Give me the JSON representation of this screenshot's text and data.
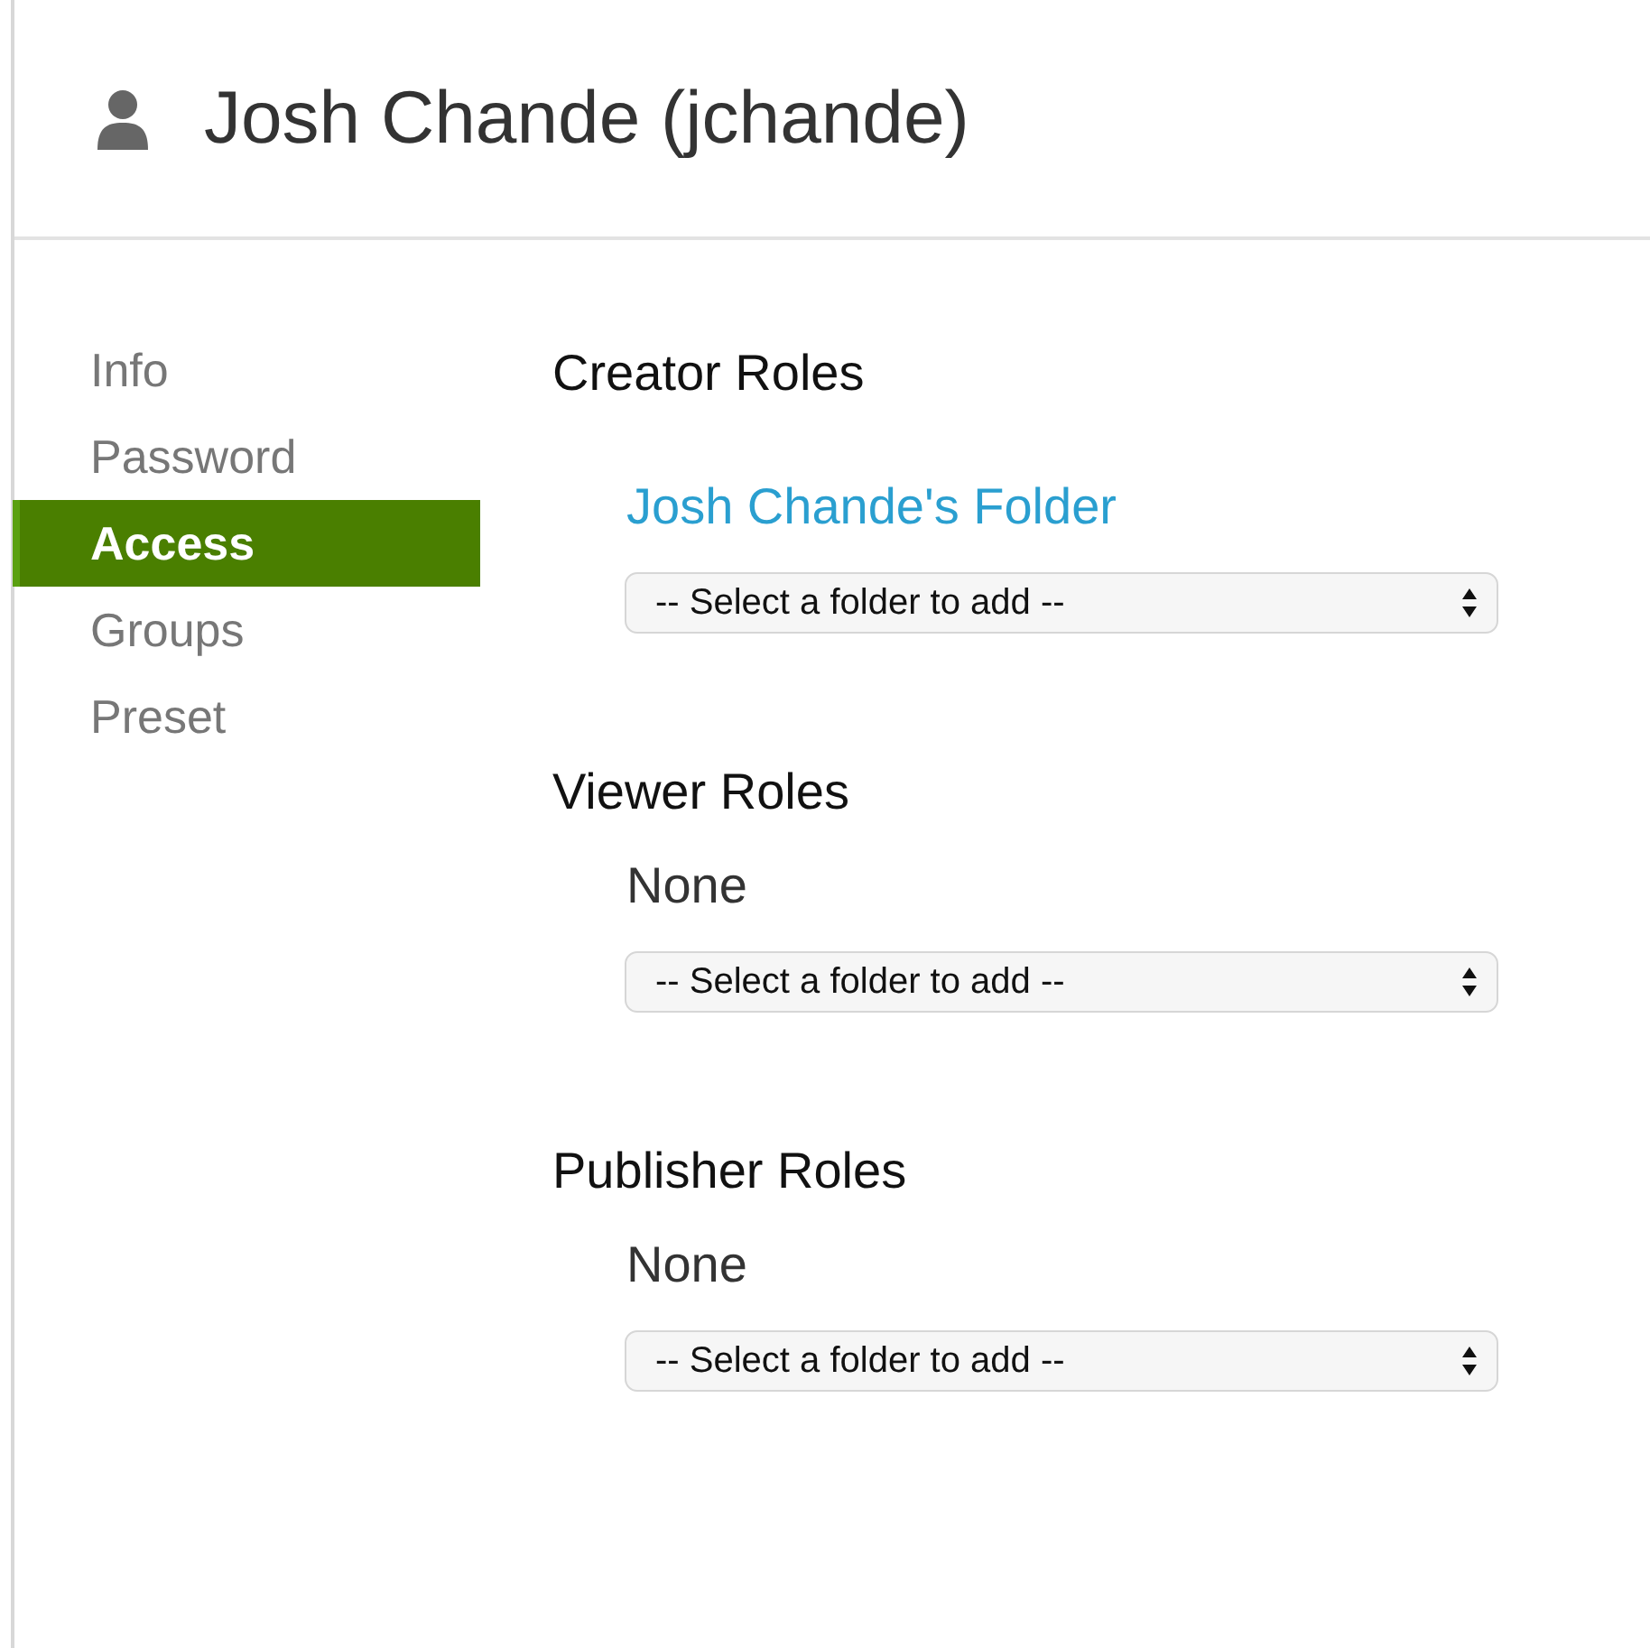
{
  "header": {
    "title": "Josh Chande (jchande)"
  },
  "sidebar": {
    "items": [
      {
        "label": "Info",
        "selected": false
      },
      {
        "label": "Password",
        "selected": false
      },
      {
        "label": "Access",
        "selected": true
      },
      {
        "label": "Groups",
        "selected": false
      },
      {
        "label": "Preset",
        "selected": false
      }
    ]
  },
  "sections": [
    {
      "title": "Creator Roles",
      "entries": [
        {
          "kind": "link",
          "text": "Josh Chande's Folder"
        }
      ],
      "select": {
        "value": "-- Select a folder to add --"
      }
    },
    {
      "title": "Viewer Roles",
      "entries": [
        {
          "kind": "text",
          "text": "None"
        }
      ],
      "select": {
        "value": "-- Select a folder to add --"
      }
    },
    {
      "title": "Publisher Roles",
      "entries": [
        {
          "kind": "text",
          "text": "None"
        }
      ],
      "select": {
        "value": "-- Select a folder to add --"
      }
    }
  ]
}
